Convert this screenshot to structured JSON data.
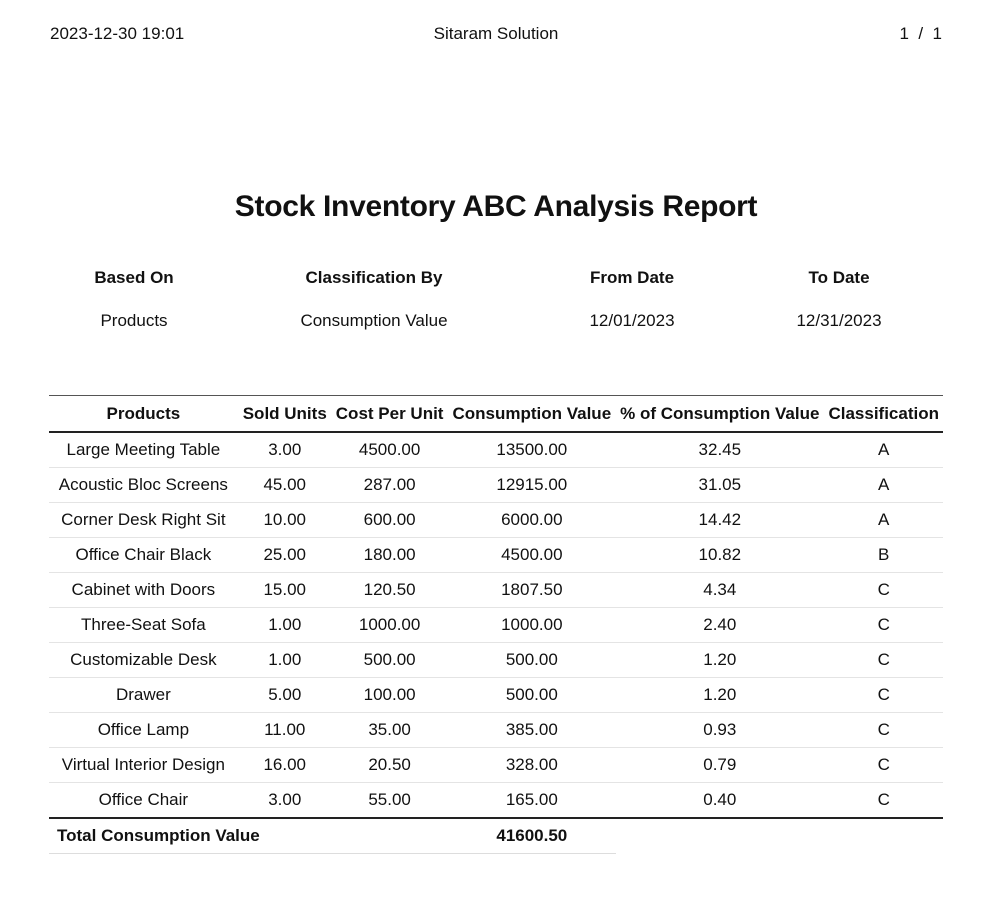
{
  "header": {
    "timestamp": "2023-12-30 19:01",
    "company": "Sitaram Solution",
    "page_indicator": "1  /  1"
  },
  "report": {
    "title": "Stock Inventory ABC Analysis Report",
    "criteria_labels": [
      "Based On",
      "Classification By",
      "From Date",
      "To Date"
    ],
    "criteria_values": [
      "Products",
      "Consumption Value",
      "12/01/2023",
      "12/31/2023"
    ]
  },
  "table": {
    "columns": [
      "Products",
      "Sold Units",
      "Cost Per Unit",
      "Consumption Value",
      "% of Consumption Value",
      "Classification"
    ],
    "rows": [
      [
        "Large Meeting Table",
        "3.00",
        "4500.00",
        "13500.00",
        "32.45",
        "A"
      ],
      [
        "Acoustic Bloc Screens",
        "45.00",
        "287.00",
        "12915.00",
        "31.05",
        "A"
      ],
      [
        "Corner Desk Right Sit",
        "10.00",
        "600.00",
        "6000.00",
        "14.42",
        "A"
      ],
      [
        "Office Chair Black",
        "25.00",
        "180.00",
        "4500.00",
        "10.82",
        "B"
      ],
      [
        "Cabinet with Doors",
        "15.00",
        "120.50",
        "1807.50",
        "4.34",
        "C"
      ],
      [
        "Three-Seat Sofa",
        "1.00",
        "1000.00",
        "1000.00",
        "2.40",
        "C"
      ],
      [
        "Customizable Desk",
        "1.00",
        "500.00",
        "500.00",
        "1.20",
        "C"
      ],
      [
        "Drawer",
        "5.00",
        "100.00",
        "500.00",
        "1.20",
        "C"
      ],
      [
        "Office Lamp",
        "11.00",
        "35.00",
        "385.00",
        "0.93",
        "C"
      ],
      [
        "Virtual Interior Design",
        "16.00",
        "20.50",
        "328.00",
        "0.79",
        "C"
      ],
      [
        "Office Chair",
        "3.00",
        "55.00",
        "165.00",
        "0.40",
        "C"
      ]
    ],
    "total_label": "Total Consumption Value",
    "total_value": "41600.50"
  }
}
